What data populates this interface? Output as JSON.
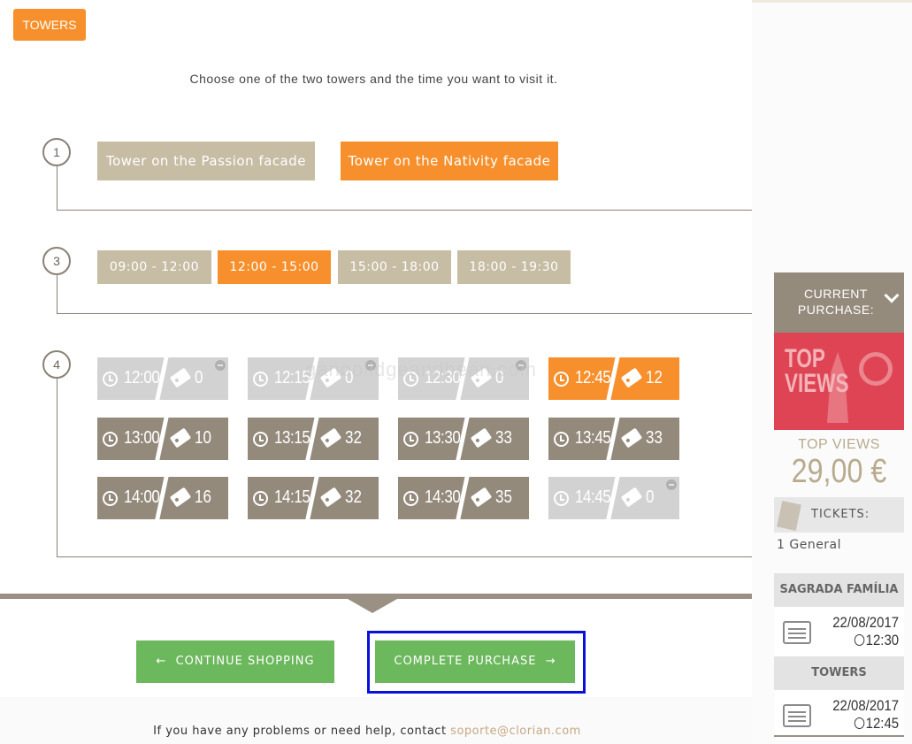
{
  "header": {
    "tab_label": "TOWERS",
    "intro": "Choose one of the two towers and the time you want to visit it."
  },
  "steps": {
    "s1": "1",
    "s3": "3",
    "s4": "4"
  },
  "towers": [
    {
      "label": "Tower on the Passion facade",
      "selected": false
    },
    {
      "label": "Tower on the Nativity facade",
      "selected": true
    }
  ],
  "ranges": [
    {
      "label": "09:00 - 12:00",
      "selected": false
    },
    {
      "label": "12:00 - 15:00",
      "selected": true
    },
    {
      "label": "15:00 - 18:00",
      "selected": false
    },
    {
      "label": "18:00 - 19:30",
      "selected": false
    }
  ],
  "slots": [
    {
      "time": "12:00",
      "count": "0",
      "state": "soldout"
    },
    {
      "time": "12:15",
      "count": "0",
      "state": "soldout"
    },
    {
      "time": "12:30",
      "count": "0",
      "state": "soldout"
    },
    {
      "time": "12:45",
      "count": "12",
      "state": "selected"
    },
    {
      "time": "13:00",
      "count": "10",
      "state": "available"
    },
    {
      "time": "13:15",
      "count": "32",
      "state": "available"
    },
    {
      "time": "13:30",
      "count": "33",
      "state": "available"
    },
    {
      "time": "13:45",
      "count": "33",
      "state": "available"
    },
    {
      "time": "14:00",
      "count": "16",
      "state": "available"
    },
    {
      "time": "14:15",
      "count": "32",
      "state": "available"
    },
    {
      "time": "14:30",
      "count": "35",
      "state": "available"
    },
    {
      "time": "14:45",
      "count": "0",
      "state": "soldout"
    }
  ],
  "watermark": "ganoolidgeandbean.com",
  "actions": {
    "continue": "CONTINUE SHOPPING",
    "complete": "COMPLETE PURCHASE"
  },
  "footer": {
    "text": "If you have any problems or need help, contact ",
    "email": "soporte@clorian.com"
  },
  "cart": {
    "header_line1": "CURRENT",
    "header_line2": "PURCHASE:",
    "promo_line1": "TOP",
    "promo_line2": "VIEWS",
    "product": "TOP VIEWS",
    "price": "29,00 €",
    "tickets_label": "TICKETS:",
    "tickets_value": "1 General",
    "venue1": "SAGRADA FAMÍLIA",
    "date1": "22/08/2017",
    "time1": "12:30",
    "venue2": "TOWERS",
    "date2": "22/08/2017",
    "time2": "12:45"
  },
  "colors": {
    "orange": "#f7902c",
    "tan": "#c7bca4",
    "green": "#6cb85c",
    "slot_available": "#948a7c",
    "slot_soldout": "#d2d2d2",
    "promo_red": "#de4453",
    "highlight_blue": "#0a10d9"
  },
  "icons": [
    "clock-icon",
    "ticket-icon",
    "minus-circle-icon",
    "arrow-left-icon",
    "arrow-right-icon",
    "chevron-down-icon",
    "calendar-icon"
  ]
}
